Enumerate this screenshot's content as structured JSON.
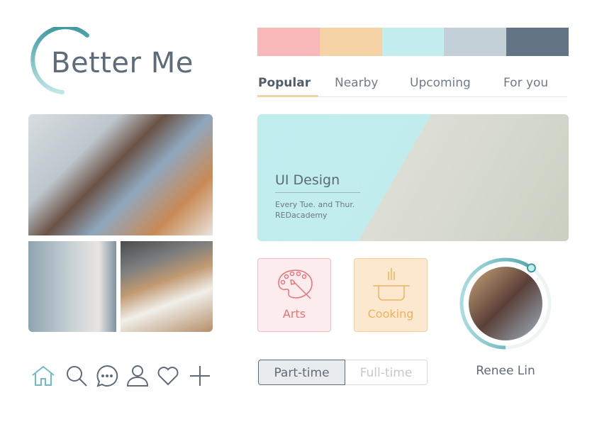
{
  "app": {
    "title": "Better Me"
  },
  "palette": [
    "#f6b8b9",
    "#f5d3a4",
    "#c4edef",
    "#c3d0d8",
    "#637584"
  ],
  "tabs": [
    {
      "label": "Popular",
      "active": true
    },
    {
      "label": "Nearby"
    },
    {
      "label": "Upcoming"
    },
    {
      "label": "For you"
    }
  ],
  "featured": {
    "title": "UI Design",
    "schedule": "Every Tue. and Thur.",
    "provider": "REDacademy"
  },
  "categories": [
    {
      "label": "Arts",
      "icon": "palette-icon",
      "color": "#e8737a"
    },
    {
      "label": "Cooking",
      "icon": "pot-icon",
      "color": "#eeb25c"
    }
  ],
  "job_type": {
    "options": [
      "Part-time",
      "Full-time"
    ],
    "selected": "Part-time"
  },
  "profile": {
    "name": "Renee Lin",
    "progress": 0.6
  },
  "nav": [
    "home-icon",
    "search-icon",
    "chat-icon",
    "user-icon",
    "heart-icon",
    "plus-icon"
  ],
  "accent": "#3e9aa0"
}
